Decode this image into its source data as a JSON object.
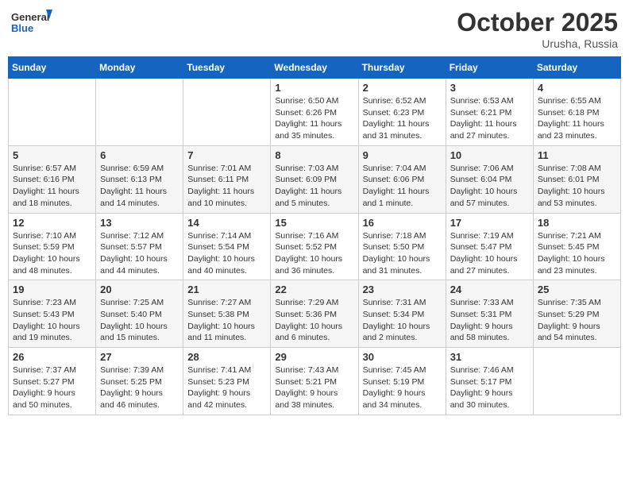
{
  "header": {
    "logo_general": "General",
    "logo_blue": "Blue",
    "month_title": "October 2025",
    "location": "Urusha, Russia"
  },
  "weekdays": [
    "Sunday",
    "Monday",
    "Tuesday",
    "Wednesday",
    "Thursday",
    "Friday",
    "Saturday"
  ],
  "weeks": [
    [
      {
        "day": "",
        "info": ""
      },
      {
        "day": "",
        "info": ""
      },
      {
        "day": "",
        "info": ""
      },
      {
        "day": "1",
        "info": "Sunrise: 6:50 AM\nSunset: 6:26 PM\nDaylight: 11 hours\nand 35 minutes."
      },
      {
        "day": "2",
        "info": "Sunrise: 6:52 AM\nSunset: 6:23 PM\nDaylight: 11 hours\nand 31 minutes."
      },
      {
        "day": "3",
        "info": "Sunrise: 6:53 AM\nSunset: 6:21 PM\nDaylight: 11 hours\nand 27 minutes."
      },
      {
        "day": "4",
        "info": "Sunrise: 6:55 AM\nSunset: 6:18 PM\nDaylight: 11 hours\nand 23 minutes."
      }
    ],
    [
      {
        "day": "5",
        "info": "Sunrise: 6:57 AM\nSunset: 6:16 PM\nDaylight: 11 hours\nand 18 minutes."
      },
      {
        "day": "6",
        "info": "Sunrise: 6:59 AM\nSunset: 6:13 PM\nDaylight: 11 hours\nand 14 minutes."
      },
      {
        "day": "7",
        "info": "Sunrise: 7:01 AM\nSunset: 6:11 PM\nDaylight: 11 hours\nand 10 minutes."
      },
      {
        "day": "8",
        "info": "Sunrise: 7:03 AM\nSunset: 6:09 PM\nDaylight: 11 hours\nand 5 minutes."
      },
      {
        "day": "9",
        "info": "Sunrise: 7:04 AM\nSunset: 6:06 PM\nDaylight: 11 hours\nand 1 minute."
      },
      {
        "day": "10",
        "info": "Sunrise: 7:06 AM\nSunset: 6:04 PM\nDaylight: 10 hours\nand 57 minutes."
      },
      {
        "day": "11",
        "info": "Sunrise: 7:08 AM\nSunset: 6:01 PM\nDaylight: 10 hours\nand 53 minutes."
      }
    ],
    [
      {
        "day": "12",
        "info": "Sunrise: 7:10 AM\nSunset: 5:59 PM\nDaylight: 10 hours\nand 48 minutes."
      },
      {
        "day": "13",
        "info": "Sunrise: 7:12 AM\nSunset: 5:57 PM\nDaylight: 10 hours\nand 44 minutes."
      },
      {
        "day": "14",
        "info": "Sunrise: 7:14 AM\nSunset: 5:54 PM\nDaylight: 10 hours\nand 40 minutes."
      },
      {
        "day": "15",
        "info": "Sunrise: 7:16 AM\nSunset: 5:52 PM\nDaylight: 10 hours\nand 36 minutes."
      },
      {
        "day": "16",
        "info": "Sunrise: 7:18 AM\nSunset: 5:50 PM\nDaylight: 10 hours\nand 31 minutes."
      },
      {
        "day": "17",
        "info": "Sunrise: 7:19 AM\nSunset: 5:47 PM\nDaylight: 10 hours\nand 27 minutes."
      },
      {
        "day": "18",
        "info": "Sunrise: 7:21 AM\nSunset: 5:45 PM\nDaylight: 10 hours\nand 23 minutes."
      }
    ],
    [
      {
        "day": "19",
        "info": "Sunrise: 7:23 AM\nSunset: 5:43 PM\nDaylight: 10 hours\nand 19 minutes."
      },
      {
        "day": "20",
        "info": "Sunrise: 7:25 AM\nSunset: 5:40 PM\nDaylight: 10 hours\nand 15 minutes."
      },
      {
        "day": "21",
        "info": "Sunrise: 7:27 AM\nSunset: 5:38 PM\nDaylight: 10 hours\nand 11 minutes."
      },
      {
        "day": "22",
        "info": "Sunrise: 7:29 AM\nSunset: 5:36 PM\nDaylight: 10 hours\nand 6 minutes."
      },
      {
        "day": "23",
        "info": "Sunrise: 7:31 AM\nSunset: 5:34 PM\nDaylight: 10 hours\nand 2 minutes."
      },
      {
        "day": "24",
        "info": "Sunrise: 7:33 AM\nSunset: 5:31 PM\nDaylight: 9 hours\nand 58 minutes."
      },
      {
        "day": "25",
        "info": "Sunrise: 7:35 AM\nSunset: 5:29 PM\nDaylight: 9 hours\nand 54 minutes."
      }
    ],
    [
      {
        "day": "26",
        "info": "Sunrise: 7:37 AM\nSunset: 5:27 PM\nDaylight: 9 hours\nand 50 minutes."
      },
      {
        "day": "27",
        "info": "Sunrise: 7:39 AM\nSunset: 5:25 PM\nDaylight: 9 hours\nand 46 minutes."
      },
      {
        "day": "28",
        "info": "Sunrise: 7:41 AM\nSunset: 5:23 PM\nDaylight: 9 hours\nand 42 minutes."
      },
      {
        "day": "29",
        "info": "Sunrise: 7:43 AM\nSunset: 5:21 PM\nDaylight: 9 hours\nand 38 minutes."
      },
      {
        "day": "30",
        "info": "Sunrise: 7:45 AM\nSunset: 5:19 PM\nDaylight: 9 hours\nand 34 minutes."
      },
      {
        "day": "31",
        "info": "Sunrise: 7:46 AM\nSunset: 5:17 PM\nDaylight: 9 hours\nand 30 minutes."
      },
      {
        "day": "",
        "info": ""
      }
    ]
  ]
}
